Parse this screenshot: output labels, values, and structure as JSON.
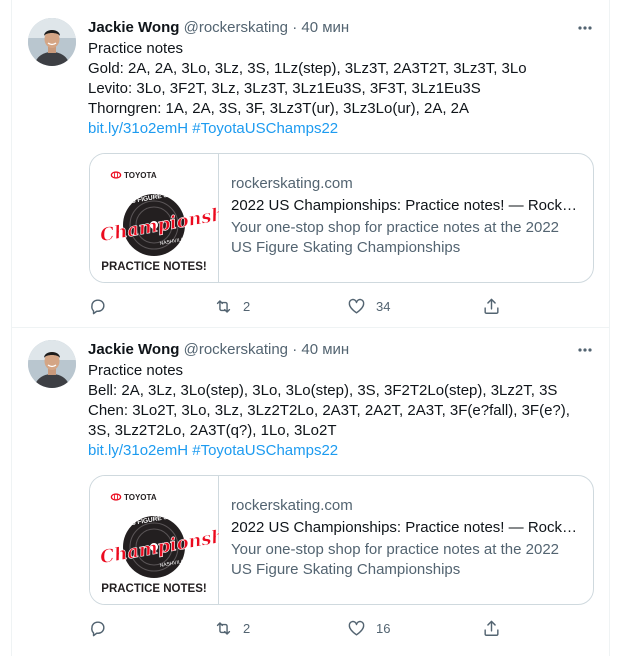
{
  "colors": {
    "link": "#1d9bf0",
    "text_primary": "#0f1419",
    "text_secondary": "#536471",
    "border": "#cfd9de",
    "toyota_red": "#eb0a1e",
    "logo_dark": "#231f20"
  },
  "card_logo": {
    "brand": "TOYOTA",
    "event_line": "US FIGURE SKATING",
    "script": "Championships",
    "city": "NASHVILLE",
    "year": "2022",
    "footer": "PRACTICE NOTES!"
  },
  "tweets": [
    {
      "author_name": "Jackie Wong",
      "handle": "@rockerskating",
      "separator": "·",
      "time": "40 мин",
      "lines": [
        "Practice notes",
        "Gold: 2A, 2A, 3Lo, 3Lz, 3S, 1Lz(step), 3Lz3T, 2A3T2T, 3Lz3T, 3Lo",
        "Levito: 3Lo, 3F2T, 3Lz, 3Lz3T, 3Lz1Eu3S, 3F3T, 3Lz1Eu3S",
        "Thorngren: 1A, 2A, 3S, 3F, 3Lz3T(ur), 3Lz3Lo(ur), 2A, 2A"
      ],
      "link_url": "bit.ly/31o2emH",
      "hashtag": "#ToyotaUSChamps22",
      "card": {
        "domain": "rockerskating.com",
        "title": "2022 US Championships: Practice notes! — Rock…",
        "description": "Your one-stop shop for practice notes at the 2022 US Figure Skating Championships"
      },
      "actions": {
        "replies": "",
        "retweets": "2",
        "likes": "34",
        "share_icon": "share-icon"
      }
    },
    {
      "author_name": "Jackie Wong",
      "handle": "@rockerskating",
      "separator": "·",
      "time": "40 мин",
      "lines": [
        "Practice notes",
        "Bell: 2A, 3Lz, 3Lo(step), 3Lo, 3Lo(step), 3S, 3F2T2Lo(step), 3Lz2T, 3S",
        "Chen: 3Lo2T, 3Lo, 3Lz, 3Lz2T2Lo, 2A3T, 2A2T, 2A3T, 3F(e?fall), 3F(e?), 3S, 3Lz2T2Lo, 2A3T(q?), 1Lo, 3Lo2T"
      ],
      "link_url": "bit.ly/31o2emH",
      "hashtag": "#ToyotaUSChamps22",
      "card": {
        "domain": "rockerskating.com",
        "title": "2022 US Championships: Practice notes! — Rock…",
        "description": "Your one-stop shop for practice notes at the 2022 US Figure Skating Championships"
      },
      "actions": {
        "replies": "",
        "retweets": "2",
        "likes": "16",
        "share_icon": "share-icon"
      }
    }
  ]
}
